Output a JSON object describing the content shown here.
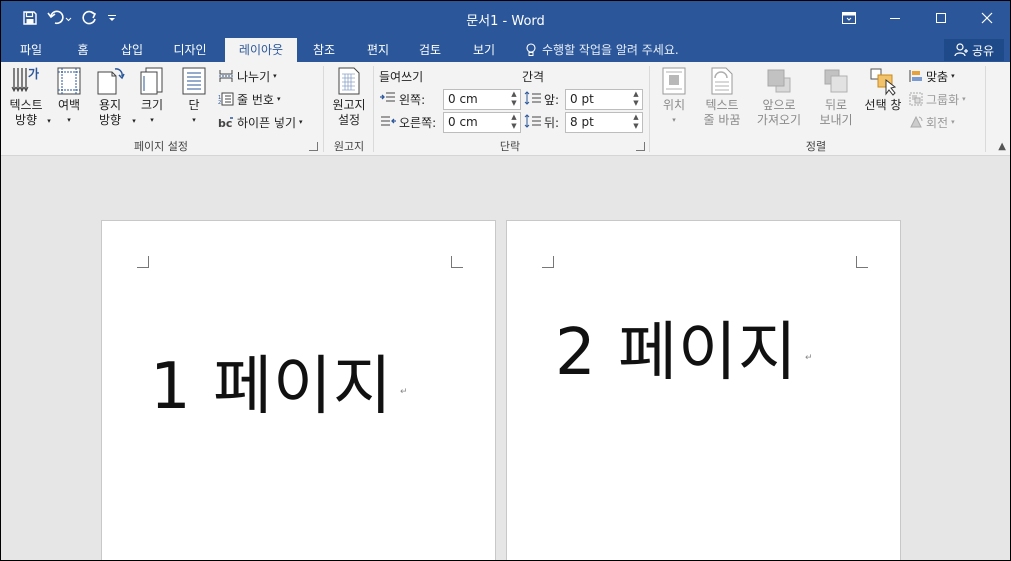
{
  "window": {
    "title": "문서1 - Word"
  },
  "qat": {
    "icons": [
      "save-icon",
      "undo-icon",
      "redo-icon",
      "customize-qat-icon"
    ]
  },
  "tabs": [
    {
      "label": "파일"
    },
    {
      "label": "홈"
    },
    {
      "label": "삽입"
    },
    {
      "label": "디자인"
    },
    {
      "label": "레이아웃"
    },
    {
      "label": "참조"
    },
    {
      "label": "편지"
    },
    {
      "label": "검토"
    },
    {
      "label": "보기"
    }
  ],
  "tell_me": "수행할 작업을 알려 주세요.",
  "share": "공유",
  "ribbon": {
    "page_setup": {
      "label": "페이지 설정",
      "text_direction": [
        "텍스트",
        "방향"
      ],
      "margins": "여백",
      "orientation": [
        "용지",
        "방향"
      ],
      "size": "크기",
      "columns": "단",
      "breaks": "나누기",
      "line_numbers": "줄 번호",
      "hyphenation": "하이픈 넣기"
    },
    "manuscript": {
      "label": "원고지",
      "button": [
        "원고지",
        "설정"
      ]
    },
    "paragraph": {
      "label": "단락",
      "indent_title": "들여쓰기",
      "indent_left_label": "왼쪽:",
      "indent_left_value": "0 cm",
      "indent_right_label": "오른쪽:",
      "indent_right_value": "0 cm",
      "spacing_title": "간격",
      "spacing_before_label": "앞:",
      "spacing_before_value": "0 pt",
      "spacing_after_label": "뒤:",
      "spacing_after_value": "8 pt"
    },
    "arrange": {
      "label": "정렬",
      "position": "위치",
      "wrap_text": [
        "텍스트",
        "줄 바꿈"
      ],
      "bring_forward": [
        "앞으로",
        "가져오기"
      ],
      "send_backward": [
        "뒤로",
        "보내기"
      ],
      "selection_pane": "선택 창",
      "align": "맞춤",
      "group": "그룹화",
      "rotate": "회전"
    }
  },
  "document": {
    "page1_text": "1 페이지",
    "page2_text": "2 페이지"
  }
}
